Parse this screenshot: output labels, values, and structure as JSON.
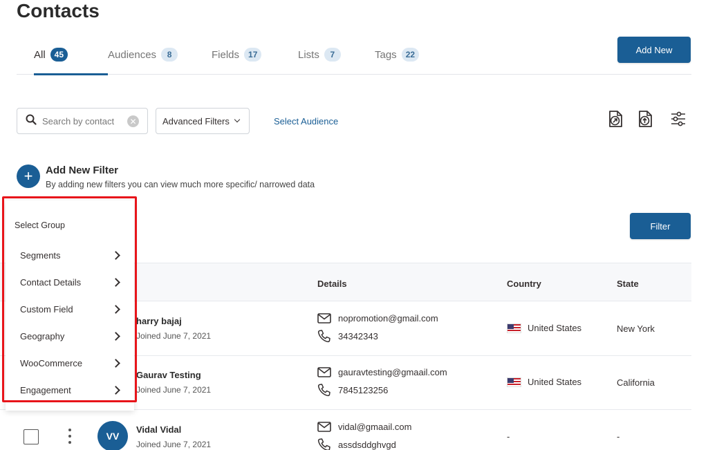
{
  "page": {
    "title": "Contacts"
  },
  "tabs": [
    {
      "label": "All",
      "count": "45",
      "active": true
    },
    {
      "label": "Audiences",
      "count": "8"
    },
    {
      "label": "Fields",
      "count": "17"
    },
    {
      "label": "Lists",
      "count": "7"
    },
    {
      "label": "Tags",
      "count": "22"
    }
  ],
  "toolbar": {
    "add_new_label": "Add New",
    "search_placeholder": "Search by contact",
    "advanced_filters_label": "Advanced Filters",
    "select_audience_label": "Select Audience",
    "icons": [
      "export-icon",
      "import-icon",
      "column-settings-icon"
    ]
  },
  "add_filter": {
    "title": "Add New Filter",
    "description": "By adding new filters you can view much more specific/ narrowed data"
  },
  "filter_button_label": "Filter",
  "dropdown": {
    "header": "Select Group",
    "items": [
      "Segments",
      "Contact Details",
      "Custom Field",
      "Geography",
      "WooCommerce",
      "Engagement"
    ]
  },
  "table": {
    "columns": [
      "Details",
      "Country",
      "State"
    ],
    "rows": [
      {
        "name": "harry bajaj",
        "joined": "Joined June 7, 2021",
        "email": "nopromotion@gmail.com",
        "phone": "34342343",
        "country": "United States",
        "state": "New York"
      },
      {
        "name": "Gaurav Testing",
        "joined": "Joined June 7, 2021",
        "email": "gauravtesting@gmaail.com",
        "phone": "7845123256",
        "country": "United States",
        "state": "California"
      },
      {
        "name": "Vidal Vidal",
        "initials": "VV",
        "joined": "Joined June 7, 2021",
        "email": "vidal@gmaail.com",
        "phone": "assdsddghvgd",
        "country": "-",
        "state": "-"
      }
    ]
  },
  "colors": {
    "primary": "#1a5e95",
    "highlight": "#e8141a"
  }
}
